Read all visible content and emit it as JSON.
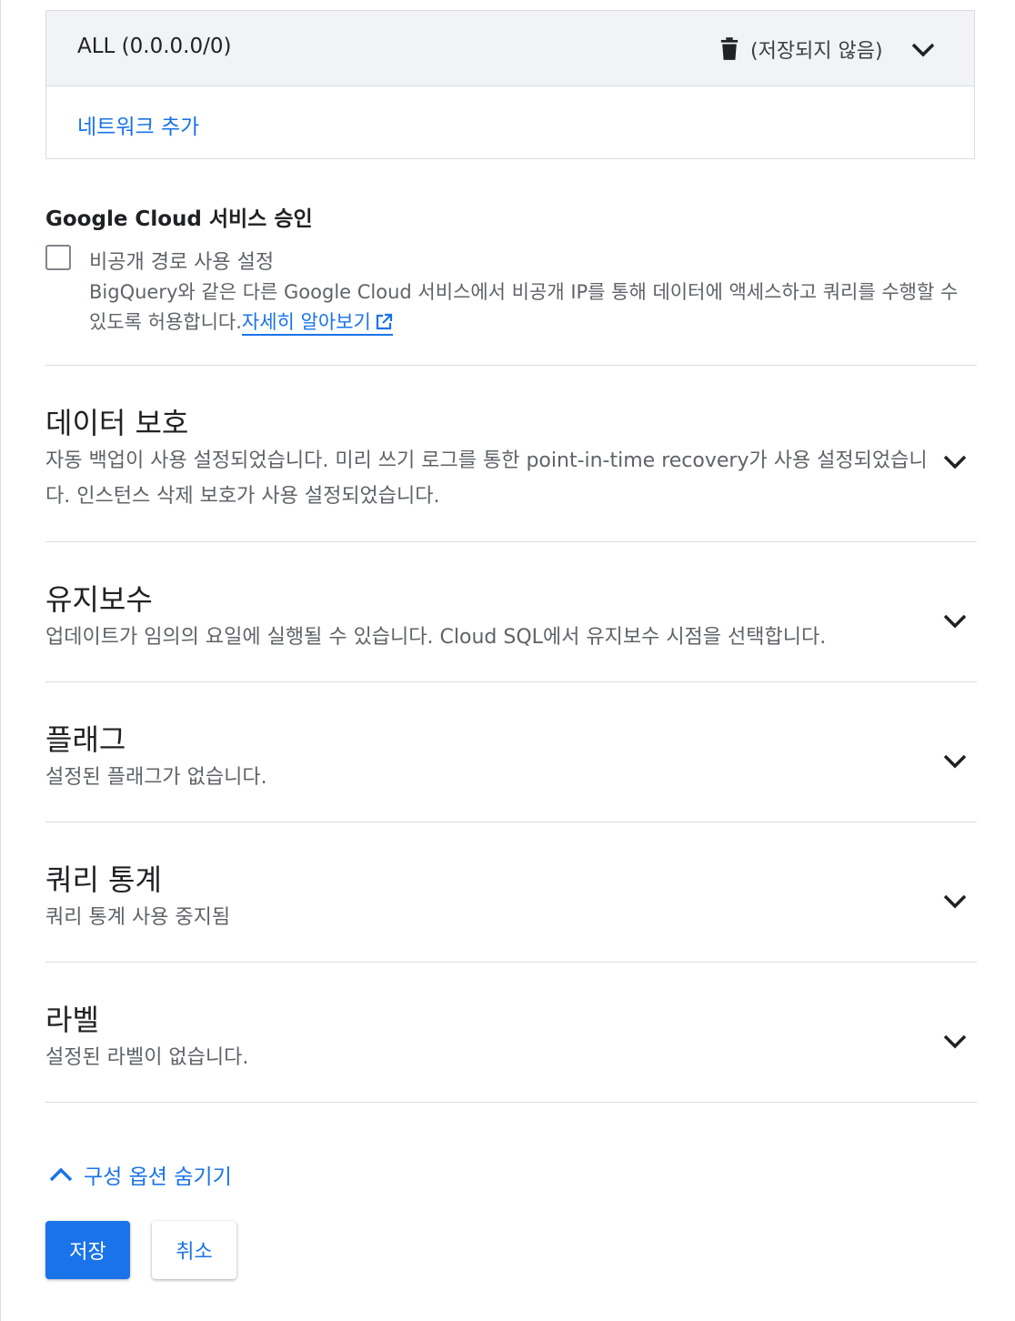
{
  "network": {
    "name": "ALL (0.0.0.0/0)",
    "status": "(저장되지 않음)",
    "add_label": "네트워크 추가"
  },
  "gcs": {
    "title": "Google Cloud 서비스 승인",
    "checkbox_label": "비공개 경로 사용 설정",
    "checked": false,
    "description": "BigQuery와 같은 다른 Google Cloud 서비스에서 비공개 IP를 통해 데이터에 액세스하고 쿼리를 수행할 수 있도록 허용합니다.",
    "learn_more": "자세히 알아보기"
  },
  "sections": [
    {
      "title": "데이터 보호",
      "desc": "자동 백업이 사용 설정되었습니다. 미리 쓰기 로그를 통한 point-in-time recovery가 사용 설정되었습니다. 인스턴스 삭제 보호가 사용 설정되었습니다."
    },
    {
      "title": "유지보수",
      "desc": "업데이트가 임의의 요일에 실행될 수 있습니다. Cloud SQL에서 유지보수 시점을 선택합니다."
    },
    {
      "title": "플래그",
      "desc": "설정된 플래그가 없습니다."
    },
    {
      "title": "쿼리 통계",
      "desc": "쿼리 통계 사용 중지됨"
    },
    {
      "title": "라벨",
      "desc": "설정된 라벨이 없습니다."
    }
  ],
  "hide_options_label": "구성 옵션 숨기기",
  "buttons": {
    "save": "저장",
    "cancel": "취소"
  },
  "colors": {
    "accent": "#1a73e8",
    "panel_bg": "#f1f3f4",
    "divider": "#dadce0"
  }
}
